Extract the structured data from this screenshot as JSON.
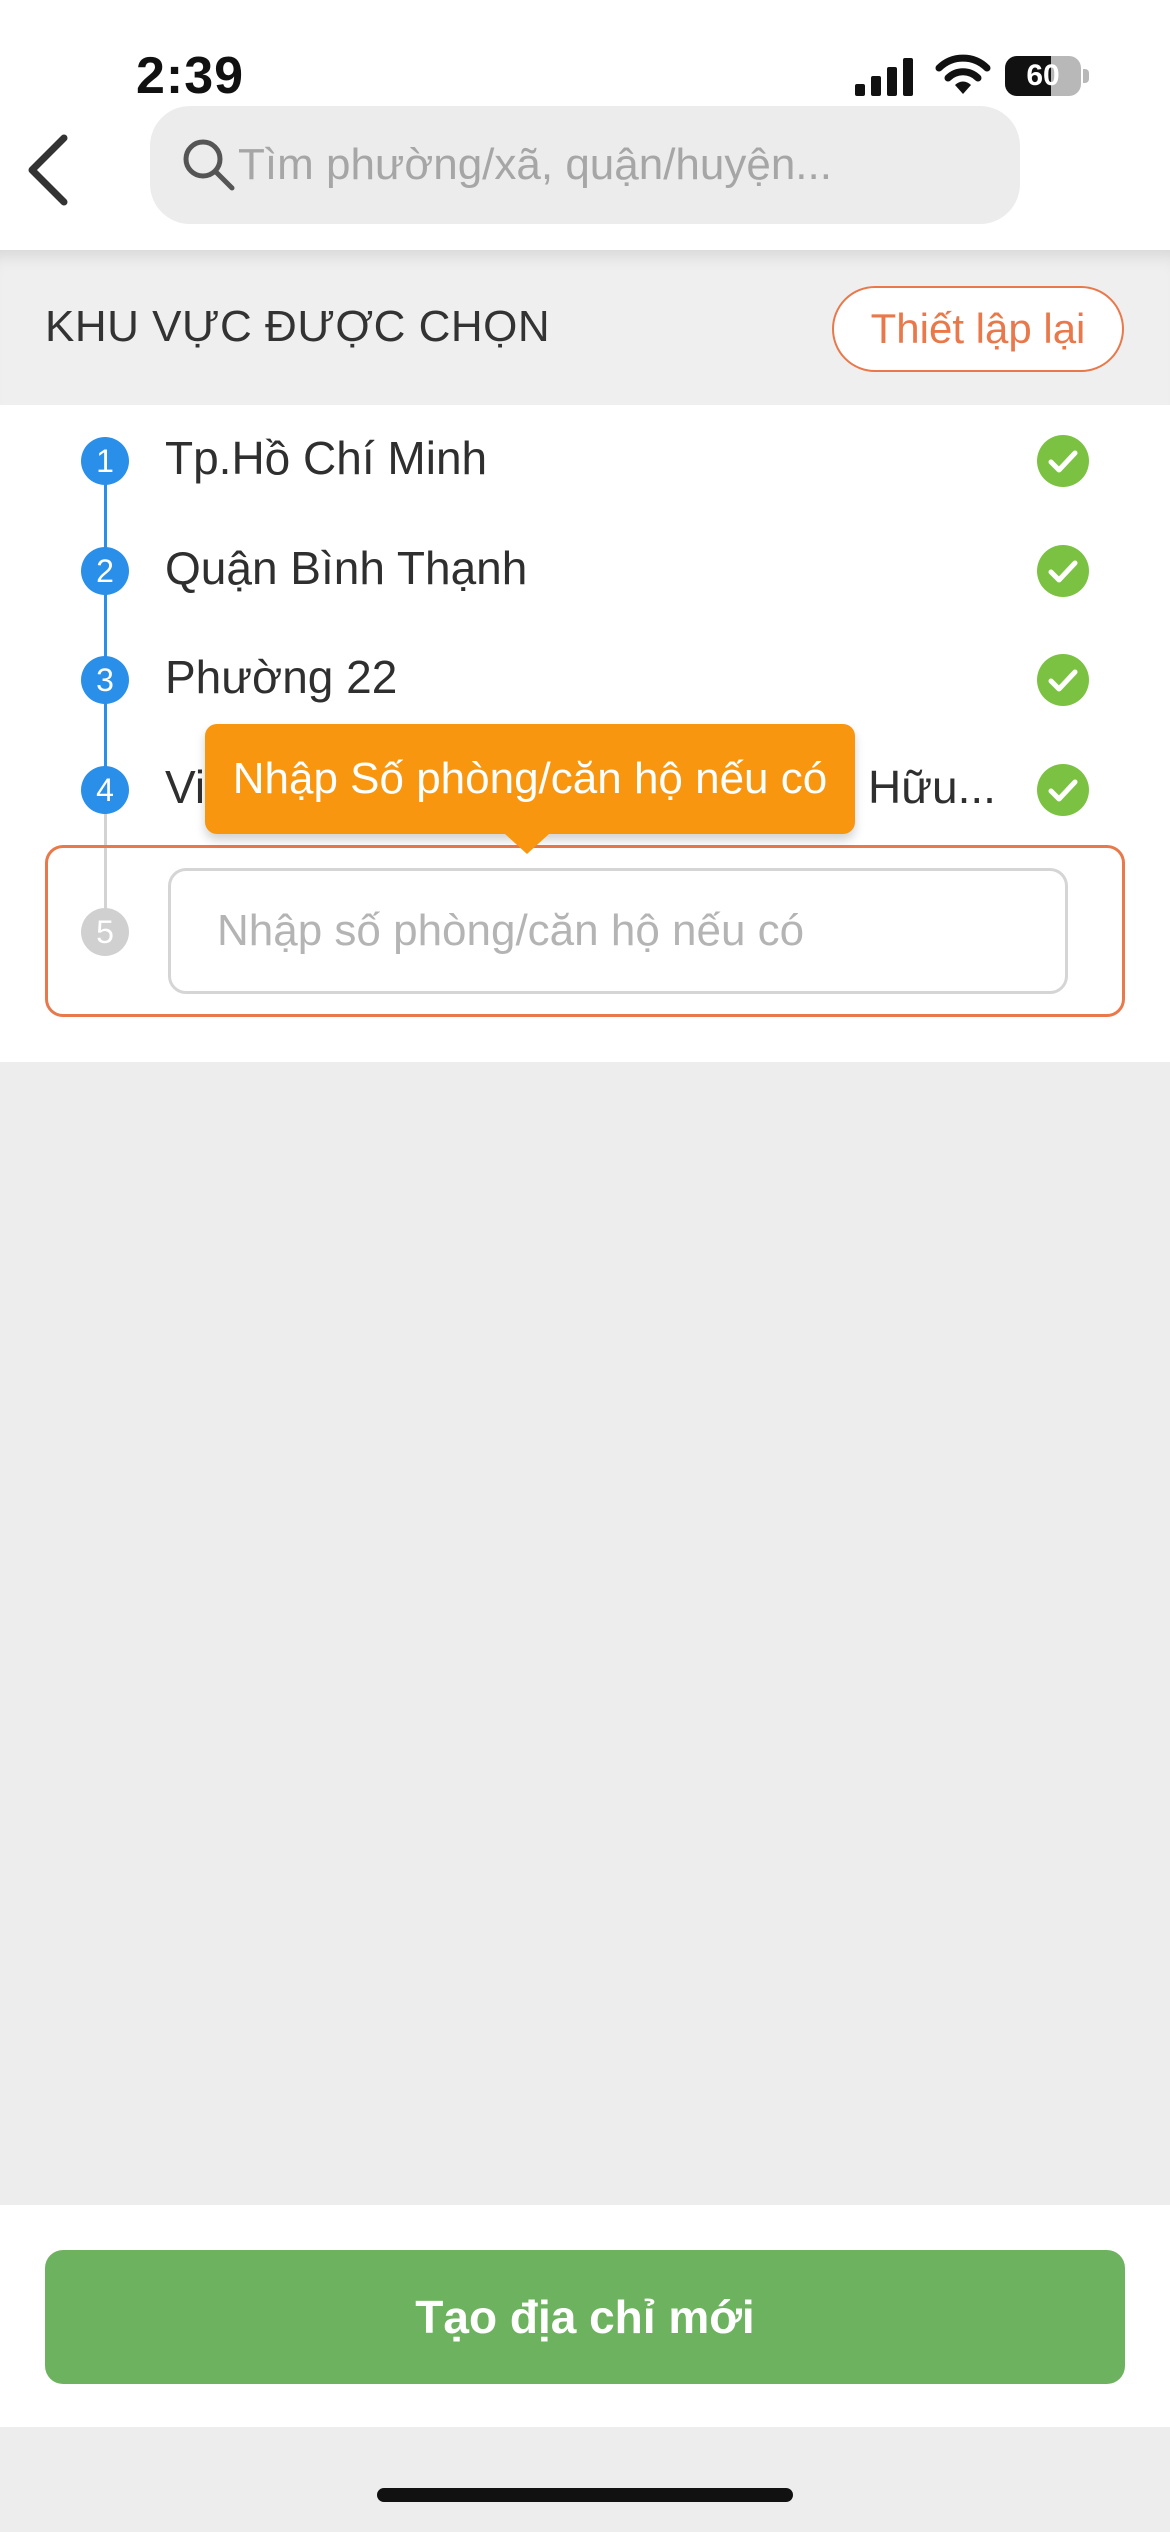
{
  "status_bar": {
    "time": "2:39",
    "battery": "60",
    "battery_level": 0.6
  },
  "search": {
    "placeholder": "Tìm phường/xã, quận/huyện..."
  },
  "section": {
    "title": "KHU VỰC ĐƯỢC CHỌN",
    "reset_label": "Thiết lập lại"
  },
  "steps": [
    {
      "number": "1",
      "label": "Tp.Hồ Chí Minh",
      "done": true
    },
    {
      "number": "2",
      "label": "Quận Bình Thạnh",
      "done": true
    },
    {
      "number": "3",
      "label": "Phường 22",
      "done": true
    },
    {
      "number": "4",
      "label": "Vi",
      "label_tail": "Hữu...",
      "done": true
    },
    {
      "number": "5",
      "placeholder": "Nhập số phòng/căn hộ nếu có",
      "done": false
    }
  ],
  "tooltip": {
    "text": "Nhập Số phòng/căn hộ nếu có"
  },
  "bottom": {
    "create_label": "Tạo địa chỉ mới"
  },
  "colors": {
    "accent_orange": "#e9784a",
    "tooltip_orange": "#f9960f",
    "step_blue": "#2a8fe8",
    "check_green": "#7cc242",
    "button_green": "#6db35f"
  },
  "icons": [
    "back-icon",
    "search-icon",
    "check-icon",
    "signal-icon",
    "wifi-icon",
    "battery-icon"
  ]
}
